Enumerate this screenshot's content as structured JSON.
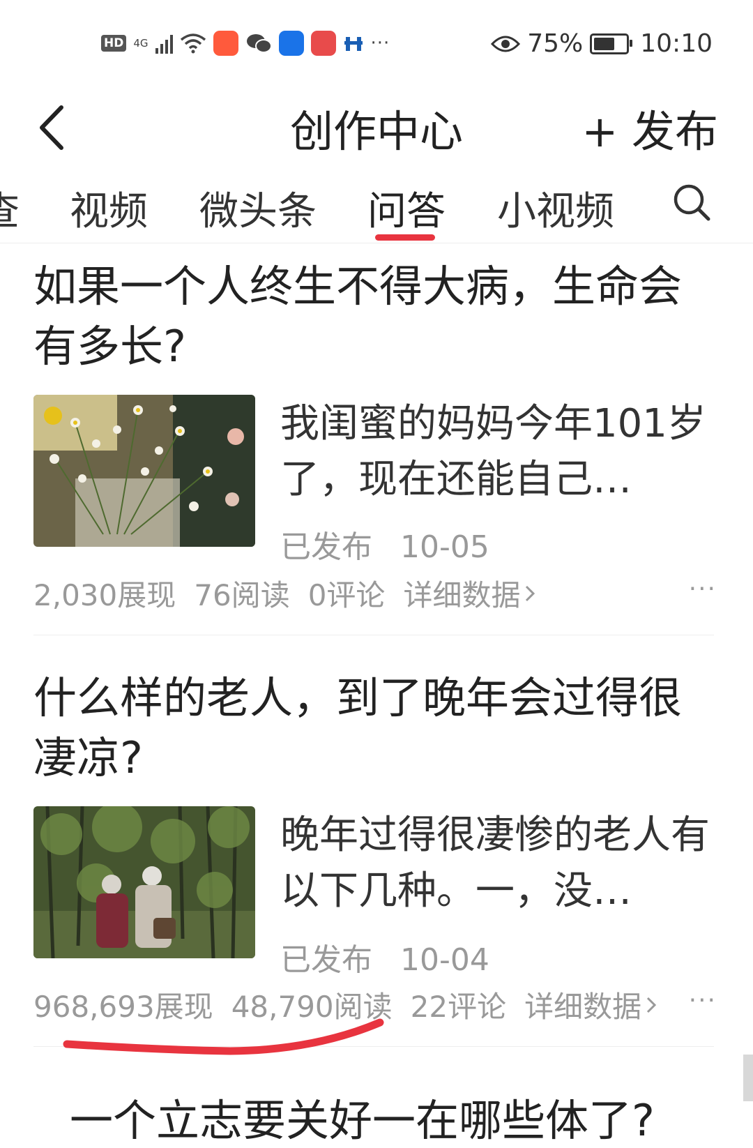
{
  "status_bar": {
    "hd": "HD",
    "network": "4G",
    "more": "···",
    "battery_percent": "75%",
    "battery_level": 0.75,
    "time": "10:10",
    "icons": [
      "hd-icon",
      "signal-icon",
      "wifi-icon",
      "kuaishou-app-icon",
      "wechat-icon",
      "bulb-app-icon",
      "reader-app-icon",
      "bridge-app-icon",
      "eye-icon",
      "battery-icon"
    ],
    "app_colors": {
      "kuaishou": "#ff5a3c",
      "bulb": "#1a73e8",
      "reader": "#e84b4b",
      "bridge": "#1a5fb4"
    }
  },
  "header": {
    "title": "创作中心",
    "publish_label": "+ 发布",
    "back_icon": "chevron-left-icon"
  },
  "tabs": {
    "items": [
      {
        "label": "查",
        "active": false
      },
      {
        "label": "视频",
        "active": false
      },
      {
        "label": "微头条",
        "active": false
      },
      {
        "label": "问答",
        "active": true
      },
      {
        "label": "小视频",
        "active": false
      }
    ],
    "accent_color": "#e8343f",
    "search_icon": "search-icon"
  },
  "posts": [
    {
      "question": "如果一个人终生不得大病，生命会有多长?",
      "excerpt": "我闺蜜的妈妈今年101岁了，现在还能自己…",
      "status": "已发布",
      "date": "10-05",
      "impressions": "2,030展现",
      "reads": "76阅读",
      "comments": "0评论",
      "detail_label": "详细数据",
      "more": "···"
    },
    {
      "question": "什么样的老人，到了晚年会过得很凄凉?",
      "excerpt": "晚年过得很凄惨的老人有以下几种。一，没…",
      "status": "已发布",
      "date": "10-04",
      "impressions": "968,693展现",
      "reads": "48,790阅读",
      "comments": "22评论",
      "detail_label": "详细数据",
      "more": "···"
    }
  ],
  "next_post_partial": "一个立志要关好一在哪些体了?",
  "annotation_color": "#e8343f"
}
